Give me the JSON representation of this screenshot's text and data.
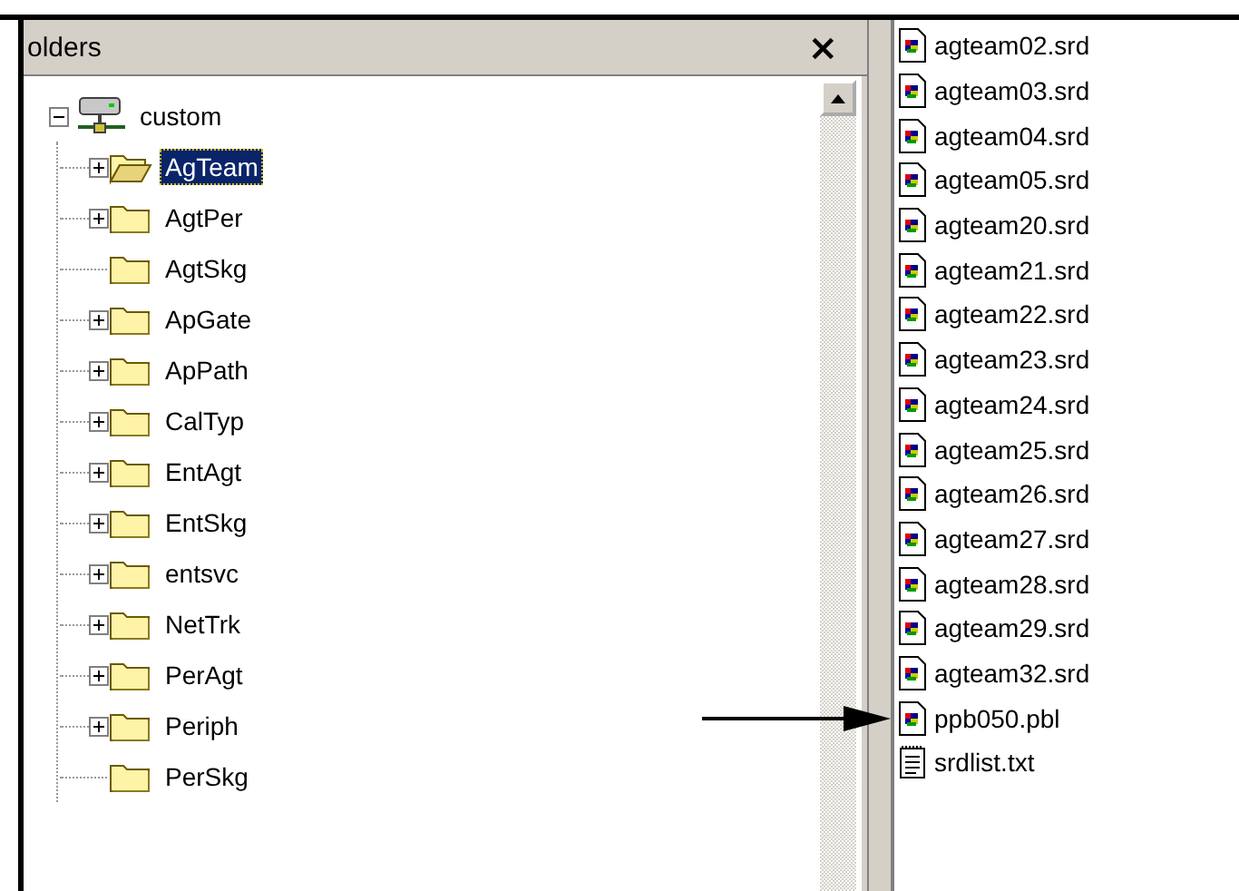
{
  "folders_panel": {
    "title": "olders",
    "close": "×"
  },
  "tree": {
    "label": "custom",
    "kind": "computer",
    "expanded": true,
    "children": [
      {
        "label": "AgTeam",
        "expandable": true,
        "selected": true
      },
      {
        "label": "AgtPer",
        "expandable": true,
        "selected": false
      },
      {
        "label": "AgtSkg",
        "expandable": false,
        "selected": false
      },
      {
        "label": "ApGate",
        "expandable": true,
        "selected": false
      },
      {
        "label": "ApPath",
        "expandable": true,
        "selected": false
      },
      {
        "label": "CalTyp",
        "expandable": true,
        "selected": false
      },
      {
        "label": "EntAgt",
        "expandable": true,
        "selected": false
      },
      {
        "label": "EntSkg",
        "expandable": true,
        "selected": false
      },
      {
        "label": "entsvc",
        "expandable": true,
        "selected": false
      },
      {
        "label": "NetTrk",
        "expandable": true,
        "selected": false
      },
      {
        "label": "PerAgt",
        "expandable": true,
        "selected": false
      },
      {
        "label": "Periph",
        "expandable": true,
        "selected": false
      },
      {
        "label": "PerSkg",
        "expandable": false,
        "selected": false
      }
    ]
  },
  "files": [
    {
      "name": "agteam02.srd",
      "kind": "datawindow",
      "marked": false
    },
    {
      "name": "agteam03.srd",
      "kind": "datawindow",
      "marked": false
    },
    {
      "name": "agteam04.srd",
      "kind": "datawindow",
      "marked": false
    },
    {
      "name": "agteam05.srd",
      "kind": "datawindow",
      "marked": false
    },
    {
      "name": "agteam20.srd",
      "kind": "datawindow",
      "marked": false
    },
    {
      "name": "agteam21.srd",
      "kind": "datawindow",
      "marked": false
    },
    {
      "name": "agteam22.srd",
      "kind": "datawindow",
      "marked": false
    },
    {
      "name": "agteam23.srd",
      "kind": "datawindow",
      "marked": false
    },
    {
      "name": "agteam24.srd",
      "kind": "datawindow",
      "marked": false
    },
    {
      "name": "agteam25.srd",
      "kind": "datawindow",
      "marked": false
    },
    {
      "name": "agteam26.srd",
      "kind": "datawindow",
      "marked": false
    },
    {
      "name": "agteam27.srd",
      "kind": "datawindow",
      "marked": false
    },
    {
      "name": "agteam28.srd",
      "kind": "datawindow",
      "marked": false
    },
    {
      "name": "agteam29.srd",
      "kind": "datawindow",
      "marked": false
    },
    {
      "name": "agteam32.srd",
      "kind": "datawindow",
      "marked": false
    },
    {
      "name": "ppb050.pbl",
      "kind": "datawindow",
      "marked": true
    },
    {
      "name": "srdlist.txt",
      "kind": "text",
      "marked": false
    }
  ]
}
